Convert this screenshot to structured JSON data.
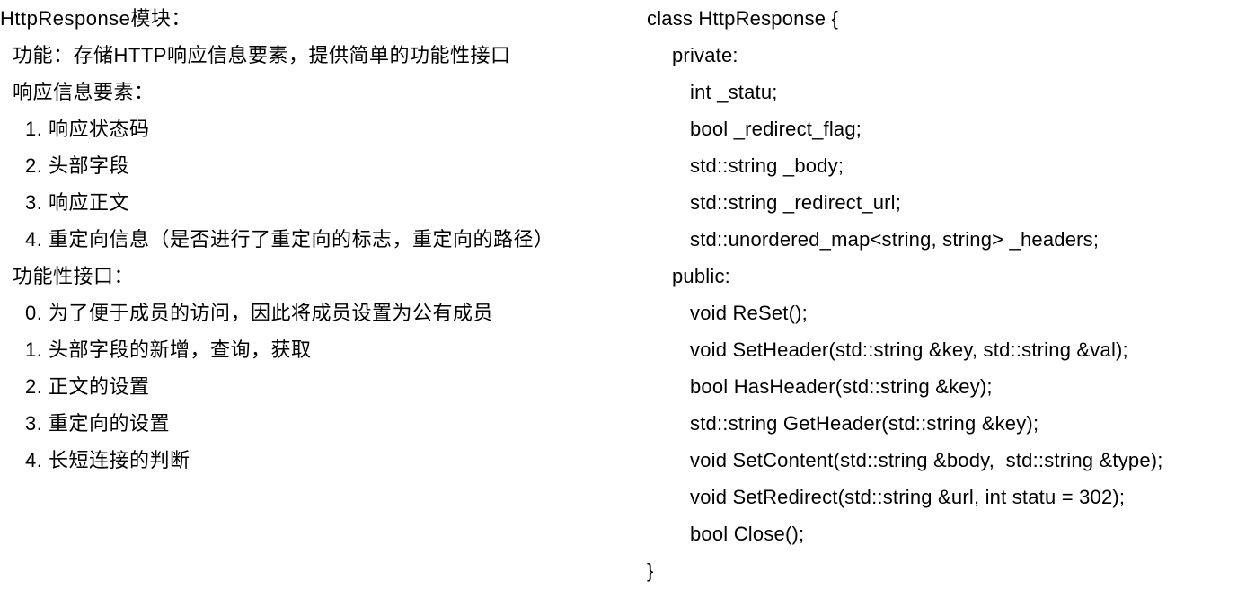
{
  "left": {
    "title": "HttpResponse模块：",
    "feature": "功能：存储HTTP响应信息要素，提供简单的功能性接口",
    "elements_header": "响应信息要素：",
    "elements": [
      "1. 响应状态码",
      "2. 头部字段",
      "3. 响应正文",
      "4. 重定向信息（是否进行了重定向的标志，重定向的路径）"
    ],
    "interfaces_header": "功能性接口：",
    "interfaces": [
      "0. 为了便于成员的访问，因此将成员设置为公有成员",
      "1. 头部字段的新增，查询，获取",
      "2. 正文的设置",
      "3. 重定向的设置",
      "4. 长短连接的判断"
    ]
  },
  "right": {
    "class_open": "class HttpResponse {",
    "private_label": "private:",
    "private_members": [
      "int _statu;",
      "bool _redirect_flag;",
      "std::string _body;",
      "std::string _redirect_url;",
      "std::unordered_map<string, string> _headers;"
    ],
    "public_label": "public:",
    "public_methods": [
      "void ReSet();",
      "void SetHeader(std::string &key, std::string &val);",
      "bool HasHeader(std::string &key);",
      "std::string GetHeader(std::string &key);",
      "void SetContent(std::string &body,  std::string &type);",
      "void SetRedirect(std::string &url, int statu = 302);",
      "bool Close();"
    ],
    "class_close": "}"
  }
}
